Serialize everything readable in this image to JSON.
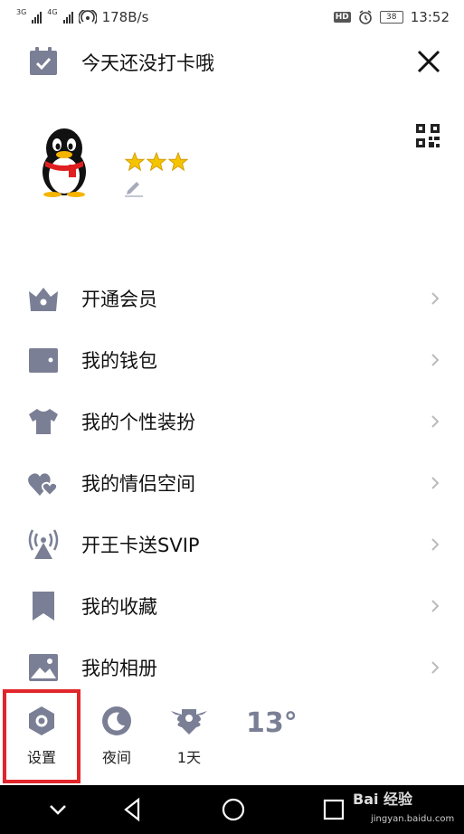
{
  "status_bar": {
    "network_1": "3G",
    "network_2": "4G",
    "speed": "178B/s",
    "hd": "HD",
    "battery": "38",
    "time": "13:52"
  },
  "header": {
    "checkin_text": "今天还没打卡哦"
  },
  "profile": {
    "star_count": 3
  },
  "menu": {
    "items": [
      {
        "label": "开通会员",
        "icon": "crown-basket-icon"
      },
      {
        "label": "我的钱包",
        "icon": "wallet-icon"
      },
      {
        "label": "我的个性装扮",
        "icon": "tshirt-icon"
      },
      {
        "label": "我的情侣空间",
        "icon": "hearts-icon"
      },
      {
        "label": "开王卡送SVIP",
        "icon": "broadcast-tower-icon"
      },
      {
        "label": "我的收藏",
        "icon": "bookmark-icon"
      },
      {
        "label": "我的相册",
        "icon": "photo-icon"
      }
    ]
  },
  "bottom_bar": {
    "settings_label": "设置",
    "night_label": "夜间",
    "days_label": "1天",
    "temperature": "13°"
  },
  "watermark": {
    "brand": "Bai 经验",
    "url": "jingyan.baidu.com"
  },
  "colors": {
    "icon_gray": "#7a7f95",
    "highlight_red": "#e0262b",
    "nav_black": "#000000"
  }
}
